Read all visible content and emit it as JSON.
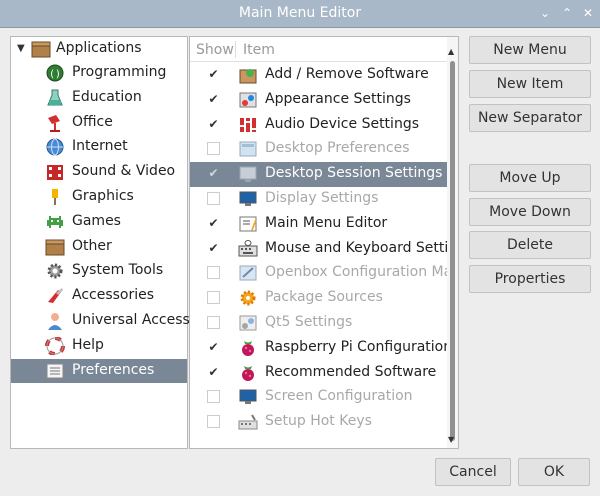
{
  "window": {
    "title": "Main Menu Editor"
  },
  "tree": {
    "root": "Applications",
    "items": [
      {
        "label": "Programming",
        "icon": "programming-icon"
      },
      {
        "label": "Education",
        "icon": "education-icon"
      },
      {
        "label": "Office",
        "icon": "office-icon"
      },
      {
        "label": "Internet",
        "icon": "globe-icon"
      },
      {
        "label": "Sound & Video",
        "icon": "sound-video-icon"
      },
      {
        "label": "Graphics",
        "icon": "graphics-icon"
      },
      {
        "label": "Games",
        "icon": "games-icon"
      },
      {
        "label": "Other",
        "icon": "folder-box-icon"
      },
      {
        "label": "System Tools",
        "icon": "gear-icon"
      },
      {
        "label": "Accessories",
        "icon": "knife-icon"
      },
      {
        "label": "Universal Access",
        "icon": "person-icon"
      },
      {
        "label": "Help",
        "icon": "lifebuoy-icon"
      },
      {
        "label": "Preferences",
        "icon": "preferences-icon",
        "selected": true
      }
    ]
  },
  "list": {
    "headers": {
      "show": "Show",
      "item": "Item"
    },
    "rows": [
      {
        "label": "Add / Remove Software",
        "checked": true,
        "icon": "package-icon"
      },
      {
        "label": "Appearance Settings",
        "checked": true,
        "icon": "appearance-icon"
      },
      {
        "label": "Audio Device Settings",
        "checked": true,
        "icon": "audio-icon"
      },
      {
        "label": "Desktop Preferences",
        "checked": false,
        "icon": "desktop-prefs-icon"
      },
      {
        "label": "Desktop Session Settings",
        "checked": true,
        "icon": "desktop-session-icon",
        "selected": true
      },
      {
        "label": "Display Settings",
        "checked": false,
        "icon": "monitor-icon"
      },
      {
        "label": "Main Menu Editor",
        "checked": true,
        "icon": "menu-editor-icon"
      },
      {
        "label": "Mouse and Keyboard Settings",
        "checked": true,
        "icon": "keyboard-icon"
      },
      {
        "label": "Openbox Configuration Manager",
        "checked": false,
        "icon": "openbox-icon"
      },
      {
        "label": "Package Sources",
        "checked": false,
        "icon": "package-sources-icon"
      },
      {
        "label": "Qt5 Settings",
        "checked": false,
        "icon": "qt-settings-icon"
      },
      {
        "label": "Raspberry Pi Configuration",
        "checked": true,
        "icon": "raspberry-icon"
      },
      {
        "label": "Recommended Software",
        "checked": true,
        "icon": "raspberry-icon"
      },
      {
        "label": "Screen Configuration",
        "checked": false,
        "icon": "monitor-icon"
      },
      {
        "label": "Setup Hot Keys",
        "checked": false,
        "icon": "hotkeys-icon"
      }
    ]
  },
  "buttons": {
    "new_menu": "New Menu",
    "new_item": "New Item",
    "new_separator": "New Separator",
    "move_up": "Move Up",
    "move_down": "Move Down",
    "delete": "Delete",
    "properties": "Properties",
    "cancel": "Cancel",
    "ok": "OK"
  },
  "colors": {
    "selection": "#7a8796",
    "titlebar": "#a8b8c8",
    "background": "#ededed"
  }
}
